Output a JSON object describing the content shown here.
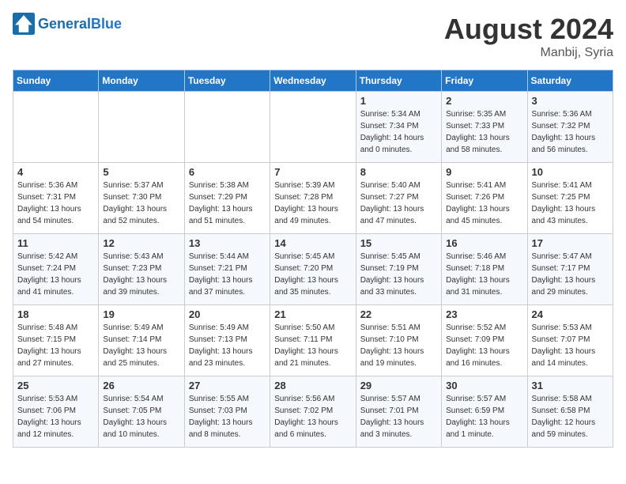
{
  "header": {
    "logo_general": "General",
    "logo_blue": "Blue",
    "month_year": "August 2024",
    "location": "Manbij, Syria"
  },
  "weekdays": [
    "Sunday",
    "Monday",
    "Tuesday",
    "Wednesday",
    "Thursday",
    "Friday",
    "Saturday"
  ],
  "weeks": [
    [
      {
        "day": "",
        "sunrise": "",
        "sunset": "",
        "daylight": ""
      },
      {
        "day": "",
        "sunrise": "",
        "sunset": "",
        "daylight": ""
      },
      {
        "day": "",
        "sunrise": "",
        "sunset": "",
        "daylight": ""
      },
      {
        "day": "",
        "sunrise": "",
        "sunset": "",
        "daylight": ""
      },
      {
        "day": "1",
        "sunrise": "Sunrise: 5:34 AM",
        "sunset": "Sunset: 7:34 PM",
        "daylight": "Daylight: 14 hours and 0 minutes."
      },
      {
        "day": "2",
        "sunrise": "Sunrise: 5:35 AM",
        "sunset": "Sunset: 7:33 PM",
        "daylight": "Daylight: 13 hours and 58 minutes."
      },
      {
        "day": "3",
        "sunrise": "Sunrise: 5:36 AM",
        "sunset": "Sunset: 7:32 PM",
        "daylight": "Daylight: 13 hours and 56 minutes."
      }
    ],
    [
      {
        "day": "4",
        "sunrise": "Sunrise: 5:36 AM",
        "sunset": "Sunset: 7:31 PM",
        "daylight": "Daylight: 13 hours and 54 minutes."
      },
      {
        "day": "5",
        "sunrise": "Sunrise: 5:37 AM",
        "sunset": "Sunset: 7:30 PM",
        "daylight": "Daylight: 13 hours and 52 minutes."
      },
      {
        "day": "6",
        "sunrise": "Sunrise: 5:38 AM",
        "sunset": "Sunset: 7:29 PM",
        "daylight": "Daylight: 13 hours and 51 minutes."
      },
      {
        "day": "7",
        "sunrise": "Sunrise: 5:39 AM",
        "sunset": "Sunset: 7:28 PM",
        "daylight": "Daylight: 13 hours and 49 minutes."
      },
      {
        "day": "8",
        "sunrise": "Sunrise: 5:40 AM",
        "sunset": "Sunset: 7:27 PM",
        "daylight": "Daylight: 13 hours and 47 minutes."
      },
      {
        "day": "9",
        "sunrise": "Sunrise: 5:41 AM",
        "sunset": "Sunset: 7:26 PM",
        "daylight": "Daylight: 13 hours and 45 minutes."
      },
      {
        "day": "10",
        "sunrise": "Sunrise: 5:41 AM",
        "sunset": "Sunset: 7:25 PM",
        "daylight": "Daylight: 13 hours and 43 minutes."
      }
    ],
    [
      {
        "day": "11",
        "sunrise": "Sunrise: 5:42 AM",
        "sunset": "Sunset: 7:24 PM",
        "daylight": "Daylight: 13 hours and 41 minutes."
      },
      {
        "day": "12",
        "sunrise": "Sunrise: 5:43 AM",
        "sunset": "Sunset: 7:23 PM",
        "daylight": "Daylight: 13 hours and 39 minutes."
      },
      {
        "day": "13",
        "sunrise": "Sunrise: 5:44 AM",
        "sunset": "Sunset: 7:21 PM",
        "daylight": "Daylight: 13 hours and 37 minutes."
      },
      {
        "day": "14",
        "sunrise": "Sunrise: 5:45 AM",
        "sunset": "Sunset: 7:20 PM",
        "daylight": "Daylight: 13 hours and 35 minutes."
      },
      {
        "day": "15",
        "sunrise": "Sunrise: 5:45 AM",
        "sunset": "Sunset: 7:19 PM",
        "daylight": "Daylight: 13 hours and 33 minutes."
      },
      {
        "day": "16",
        "sunrise": "Sunrise: 5:46 AM",
        "sunset": "Sunset: 7:18 PM",
        "daylight": "Daylight: 13 hours and 31 minutes."
      },
      {
        "day": "17",
        "sunrise": "Sunrise: 5:47 AM",
        "sunset": "Sunset: 7:17 PM",
        "daylight": "Daylight: 13 hours and 29 minutes."
      }
    ],
    [
      {
        "day": "18",
        "sunrise": "Sunrise: 5:48 AM",
        "sunset": "Sunset: 7:15 PM",
        "daylight": "Daylight: 13 hours and 27 minutes."
      },
      {
        "day": "19",
        "sunrise": "Sunrise: 5:49 AM",
        "sunset": "Sunset: 7:14 PM",
        "daylight": "Daylight: 13 hours and 25 minutes."
      },
      {
        "day": "20",
        "sunrise": "Sunrise: 5:49 AM",
        "sunset": "Sunset: 7:13 PM",
        "daylight": "Daylight: 13 hours and 23 minutes."
      },
      {
        "day": "21",
        "sunrise": "Sunrise: 5:50 AM",
        "sunset": "Sunset: 7:11 PM",
        "daylight": "Daylight: 13 hours and 21 minutes."
      },
      {
        "day": "22",
        "sunrise": "Sunrise: 5:51 AM",
        "sunset": "Sunset: 7:10 PM",
        "daylight": "Daylight: 13 hours and 19 minutes."
      },
      {
        "day": "23",
        "sunrise": "Sunrise: 5:52 AM",
        "sunset": "Sunset: 7:09 PM",
        "daylight": "Daylight: 13 hours and 16 minutes."
      },
      {
        "day": "24",
        "sunrise": "Sunrise: 5:53 AM",
        "sunset": "Sunset: 7:07 PM",
        "daylight": "Daylight: 13 hours and 14 minutes."
      }
    ],
    [
      {
        "day": "25",
        "sunrise": "Sunrise: 5:53 AM",
        "sunset": "Sunset: 7:06 PM",
        "daylight": "Daylight: 13 hours and 12 minutes."
      },
      {
        "day": "26",
        "sunrise": "Sunrise: 5:54 AM",
        "sunset": "Sunset: 7:05 PM",
        "daylight": "Daylight: 13 hours and 10 minutes."
      },
      {
        "day": "27",
        "sunrise": "Sunrise: 5:55 AM",
        "sunset": "Sunset: 7:03 PM",
        "daylight": "Daylight: 13 hours and 8 minutes."
      },
      {
        "day": "28",
        "sunrise": "Sunrise: 5:56 AM",
        "sunset": "Sunset: 7:02 PM",
        "daylight": "Daylight: 13 hours and 6 minutes."
      },
      {
        "day": "29",
        "sunrise": "Sunrise: 5:57 AM",
        "sunset": "Sunset: 7:01 PM",
        "daylight": "Daylight: 13 hours and 3 minutes."
      },
      {
        "day": "30",
        "sunrise": "Sunrise: 5:57 AM",
        "sunset": "Sunset: 6:59 PM",
        "daylight": "Daylight: 13 hours and 1 minute."
      },
      {
        "day": "31",
        "sunrise": "Sunrise: 5:58 AM",
        "sunset": "Sunset: 6:58 PM",
        "daylight": "Daylight: 12 hours and 59 minutes."
      }
    ]
  ]
}
